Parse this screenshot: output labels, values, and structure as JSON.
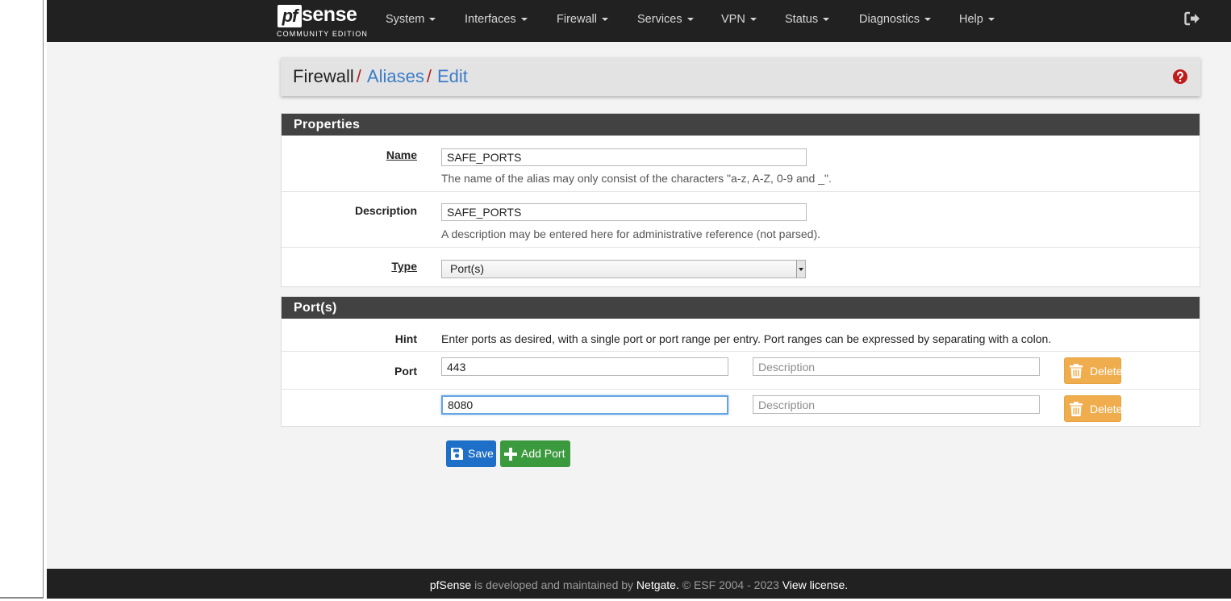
{
  "brand": {
    "logo_mark": "pf",
    "logo_word": "sense",
    "edition": "COMMUNITY EDITION"
  },
  "nav": {
    "items": [
      {
        "label": "System"
      },
      {
        "label": "Interfaces"
      },
      {
        "label": "Firewall"
      },
      {
        "label": "Services"
      },
      {
        "label": "VPN"
      },
      {
        "label": "Status"
      },
      {
        "label": "Diagnostics"
      },
      {
        "label": "Help"
      }
    ],
    "logout_icon": "sign-out-icon"
  },
  "breadcrumb": {
    "root": "Firewall",
    "sep": "/",
    "level2": "Aliases",
    "level3": "Edit",
    "help_icon": "question-circle-icon"
  },
  "properties": {
    "heading": "Properties",
    "name_label": "Name",
    "name_value": "SAFE_PORTS",
    "name_help": "The name of the alias may only consist of the characters \"a-z, A-Z, 0-9 and _\".",
    "description_label": "Description",
    "description_value": "SAFE_PORTS",
    "description_help": "A description may be entered here for administrative reference (not parsed).",
    "type_label": "Type",
    "type_value": "Port(s)"
  },
  "ports": {
    "heading": "Port(s)",
    "hint_label": "Hint",
    "hint_text": "Enter ports as desired, with a single port or port range per entry. Port ranges can be expressed by separating with a colon.",
    "port_label": "Port",
    "rows": [
      {
        "port": "443",
        "description_placeholder": "Description",
        "delete_label": "Delete"
      },
      {
        "port": "8080",
        "description_placeholder": "Description",
        "delete_label": "Delete"
      }
    ]
  },
  "actions": {
    "save_label": "Save",
    "add_port_label": "Add Port"
  },
  "footer": {
    "brand": "pfSense",
    "text1": " is developed and maintained by ",
    "company": "Netgate.",
    "text2": " © ESF 2004 - 2023 ",
    "license": "View license."
  },
  "colors": {
    "navbar": "#212121",
    "panel_heading": "#424242",
    "link": "#3a7cc7",
    "save": "#1e6fc7",
    "add": "#3c9a3e",
    "delete": "#f0ad4e",
    "help": "#c01a1a"
  }
}
